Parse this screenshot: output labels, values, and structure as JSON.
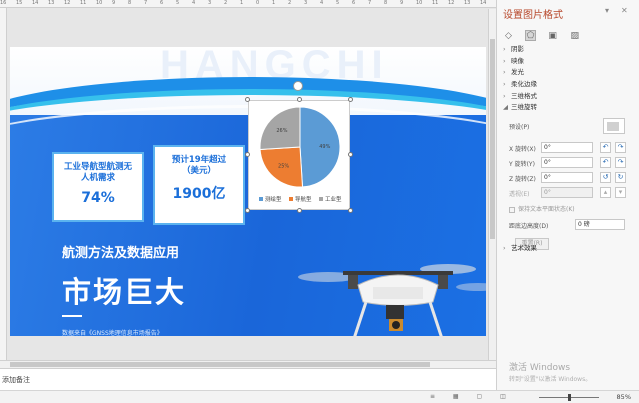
{
  "ruler": {
    "ticks": [
      "16",
      "15",
      "14",
      "13",
      "12",
      "11",
      "10",
      "9",
      "8",
      "7",
      "6",
      "5",
      "4",
      "3",
      "2",
      "1",
      "0",
      "1",
      "2",
      "3",
      "4",
      "5",
      "6",
      "7",
      "8",
      "9",
      "10",
      "11",
      "12",
      "13",
      "14",
      "15",
      "16"
    ]
  },
  "slide": {
    "bg_letters": "HANGCHI",
    "stat1": {
      "title": "工业导航型航测无人机需求",
      "value": "74%"
    },
    "stat2": {
      "title": "预计19年超过（美元）",
      "value": "1900亿"
    },
    "subtitle": "航测方法及数据应用",
    "headline": "市场巨大",
    "source": "数据来自《GNSS地理信息市场报告》",
    "colors": {
      "primary": "#1b6fd9",
      "accent": "#36c0ec"
    }
  },
  "chart_data": {
    "type": "pie",
    "title": "",
    "labels": [
      "测绘型",
      "导航型",
      "工业型"
    ],
    "values": [
      49,
      25,
      26
    ],
    "data_labels": [
      "49%",
      "25%",
      "26%"
    ],
    "colors": [
      "#5b9bd5",
      "#ed7d31",
      "#a5a5a5"
    ],
    "legend": "bottom"
  },
  "notes": {
    "placeholder": "添加备注"
  },
  "status": {
    "zoom": "85%",
    "icons": "≡ ▦ ▢ ◫"
  },
  "panel": {
    "title": "设置图片格式",
    "tabs": [
      "◇",
      "⬠",
      "▣",
      "▨"
    ],
    "sections": [
      "阴影",
      "映像",
      "发光",
      "柔化边缘",
      "三维格式",
      "三维旋转"
    ],
    "rotation": {
      "preset_label": "预设(P)",
      "x_label": "X 旋转(X)",
      "x_value": "0°",
      "y_label": "Y 旋转(Y)",
      "y_value": "0°",
      "z_label": "Z 旋转(Z)",
      "z_value": "0°",
      "persp_label": "透视(E)",
      "persp_value": "0°",
      "keep_flat": "保持文本平面状态(K)",
      "dist_label": "距底边高度(D)",
      "dist_value": "0 磅",
      "reset": "重置(R)"
    },
    "art": "艺术效果"
  },
  "activation": {
    "line1": "激活 Windows",
    "line2": "转到\"设置\"以激活 Windows。"
  }
}
